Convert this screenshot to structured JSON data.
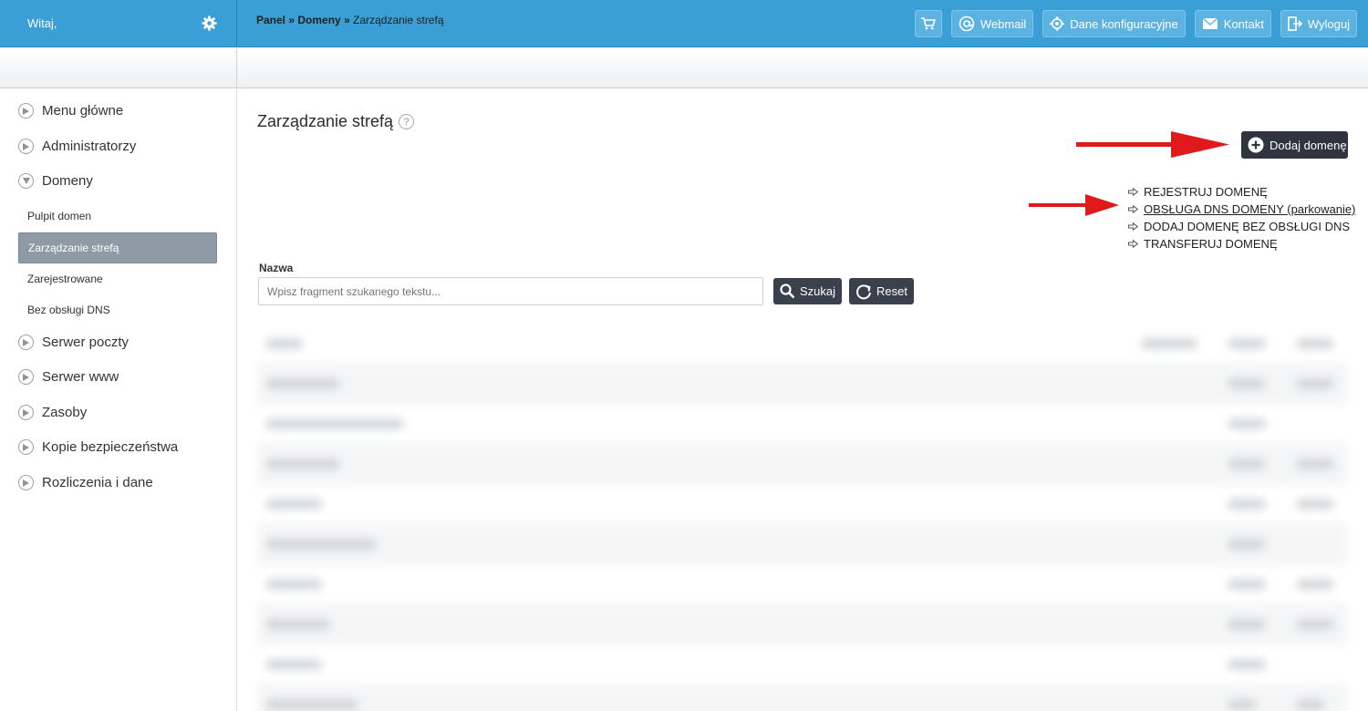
{
  "header": {
    "welcome": "Witaj,",
    "buttons": [
      {
        "label": "",
        "icon": "cart-icon"
      },
      {
        "label": "Webmail",
        "icon": "at-icon"
      },
      {
        "label": "Dane konfiguracyjne",
        "icon": "gear-icon"
      },
      {
        "label": "Kontakt",
        "icon": "envelope-icon"
      },
      {
        "label": "Wyloguj",
        "icon": "logout-icon"
      }
    ]
  },
  "breadcrumb": {
    "panel": "Panel",
    "sep1": "»",
    "domeny": "Domeny",
    "sep2": "»",
    "current": "Zarządzanie strefą"
  },
  "sidebar": {
    "items": [
      {
        "label": "Menu główne",
        "icon": "play-circle-icon"
      },
      {
        "label": "Administratorzy",
        "icon": "play-circle-icon"
      },
      {
        "label": "Domeny",
        "icon": "down-circle-icon"
      },
      {
        "label": "Serwer poczty",
        "icon": "play-circle-icon"
      },
      {
        "label": "Serwer www",
        "icon": "play-circle-icon"
      },
      {
        "label": "Zasoby",
        "icon": "play-circle-icon"
      },
      {
        "label": "Kopie bezpieczeństwa",
        "icon": "play-circle-icon"
      },
      {
        "label": "Rozliczenia i dane",
        "icon": "play-circle-icon"
      }
    ],
    "subitems": [
      {
        "label": "Pulpit domen"
      },
      {
        "label": "Zarządzanie strefą",
        "active": true
      },
      {
        "label": "Zarejestrowane"
      },
      {
        "label": "Bez obsługi DNS"
      }
    ]
  },
  "main": {
    "title": "Zarządzanie strefą",
    "help": "?",
    "add_button": "Dodaj domenę",
    "links": [
      {
        "label": "REJESTRUJ DOMENĘ"
      },
      {
        "label": "OBSŁUGA DNS DOMENY (parkowanie)"
      },
      {
        "label": "DODAJ DOMENĘ BEZ OBSŁUGI DNS"
      },
      {
        "label": "TRANSFERUJ DOMENĘ"
      }
    ],
    "filter": {
      "label": "Nazwa",
      "placeholder": "Wpisz fragment szukanego tekstu...",
      "search_button": "Szukaj",
      "reset_button": "Reset"
    }
  },
  "colors": {
    "topbar": "#3a9fd5",
    "dark_button": "#2f3440",
    "active_item": "#8e9aa6",
    "annotation_arrow": "#e01a1a"
  }
}
